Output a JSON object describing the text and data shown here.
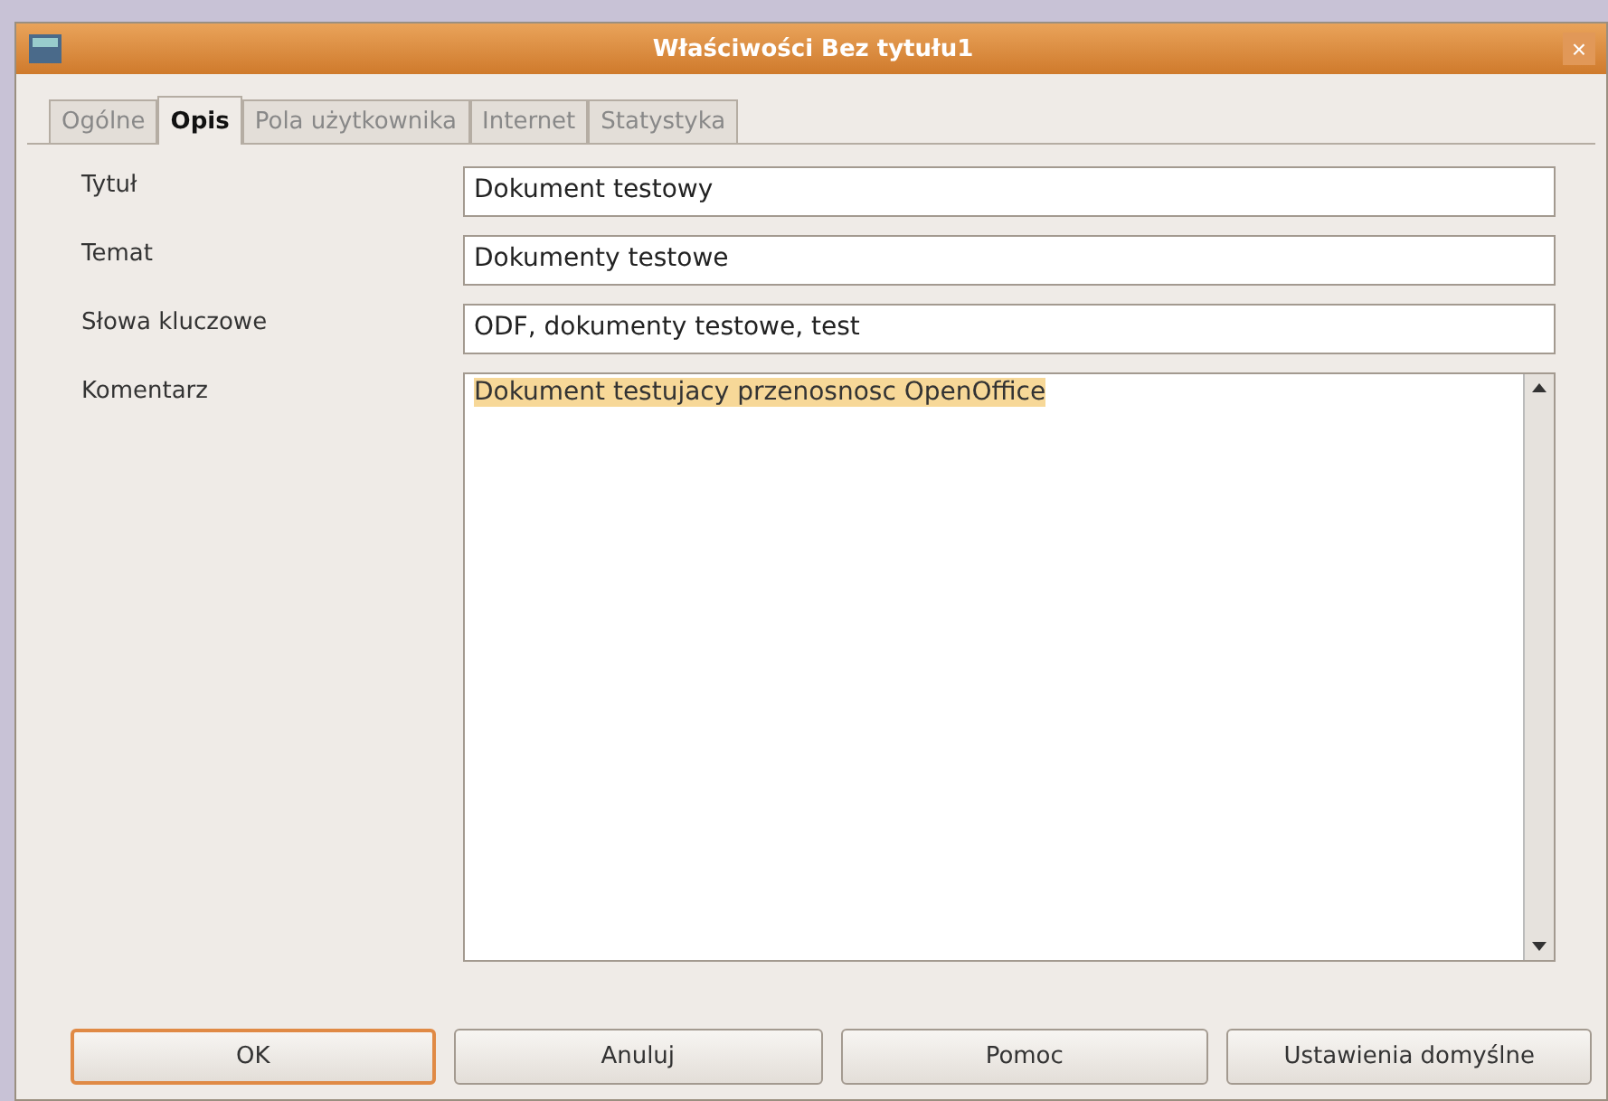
{
  "window": {
    "title": "Właściwości Bez tytułu1",
    "close": "×"
  },
  "tabs": [
    {
      "label": "Ogólne",
      "selected": false
    },
    {
      "label": "Opis",
      "selected": true
    },
    {
      "label": "Pola użytkownika",
      "selected": false
    },
    {
      "label": "Internet",
      "selected": false
    },
    {
      "label": "Statystyka",
      "selected": false
    }
  ],
  "fields": [
    {
      "label": "Tytuł",
      "value": "Dokument testowy"
    },
    {
      "label": "Temat",
      "value": "Dokumenty testowe"
    },
    {
      "label": "Słowa kluczowe",
      "value": "ODF, dokumenty testowe, test"
    }
  ],
  "comment": {
    "label": "Komentarz",
    "value": "Dokument testujacy przenosnosc OpenOffice",
    "selected": true
  },
  "buttons": [
    {
      "label": "OK",
      "default": true
    },
    {
      "label": "Anuluj",
      "default": false
    },
    {
      "label": "Pomoc",
      "default": false
    },
    {
      "label": "Ustawienia domyślne",
      "default": false
    }
  ]
}
